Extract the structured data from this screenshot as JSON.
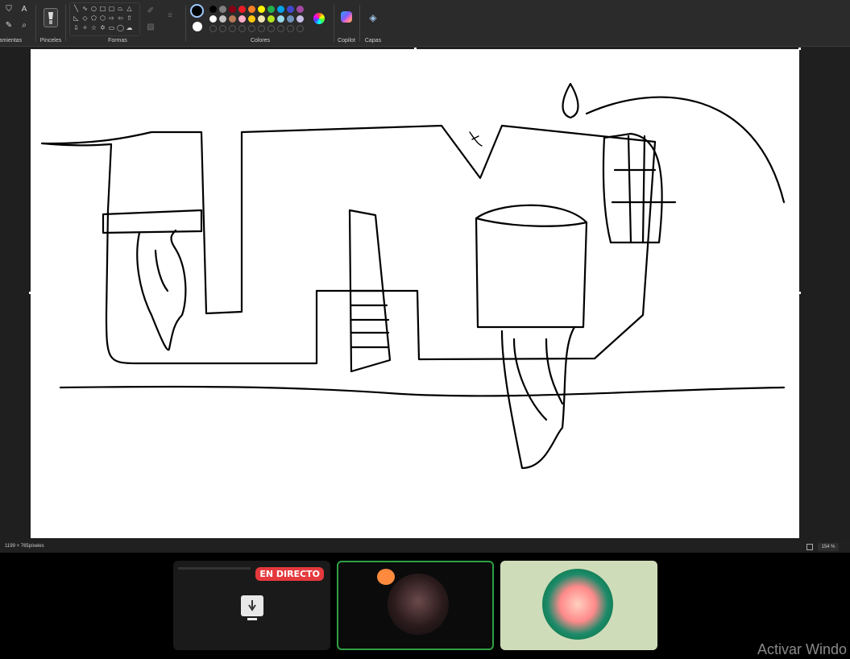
{
  "ribbon": {
    "groups": {
      "tools": "rramientas",
      "brushes": "Pinceles",
      "shapes": "Formas",
      "colors": "Colores",
      "copilot": "Copilot",
      "layers": "Capas"
    },
    "palette_row1": [
      "#000000",
      "#7f7f7f",
      "#880015",
      "#ed1c24",
      "#ff7f27",
      "#fff200",
      "#22b14c",
      "#00a2e8",
      "#3f48cc",
      "#a349a4"
    ],
    "palette_row2": [
      "#ffffff",
      "#c3c3c3",
      "#b97a57",
      "#ffaec9",
      "#ffc90e",
      "#efe4b0",
      "#b5e61d",
      "#99d9ea",
      "#7092be",
      "#c8bfe7"
    ],
    "primary_color": "#000000",
    "secondary_color": "#ffffff"
  },
  "status": {
    "dimensions": "1199 × 765píxeles",
    "zoom": "154 %"
  },
  "call": {
    "live_badge": "EN DIRECTO"
  },
  "watermark": "Activar Windo"
}
